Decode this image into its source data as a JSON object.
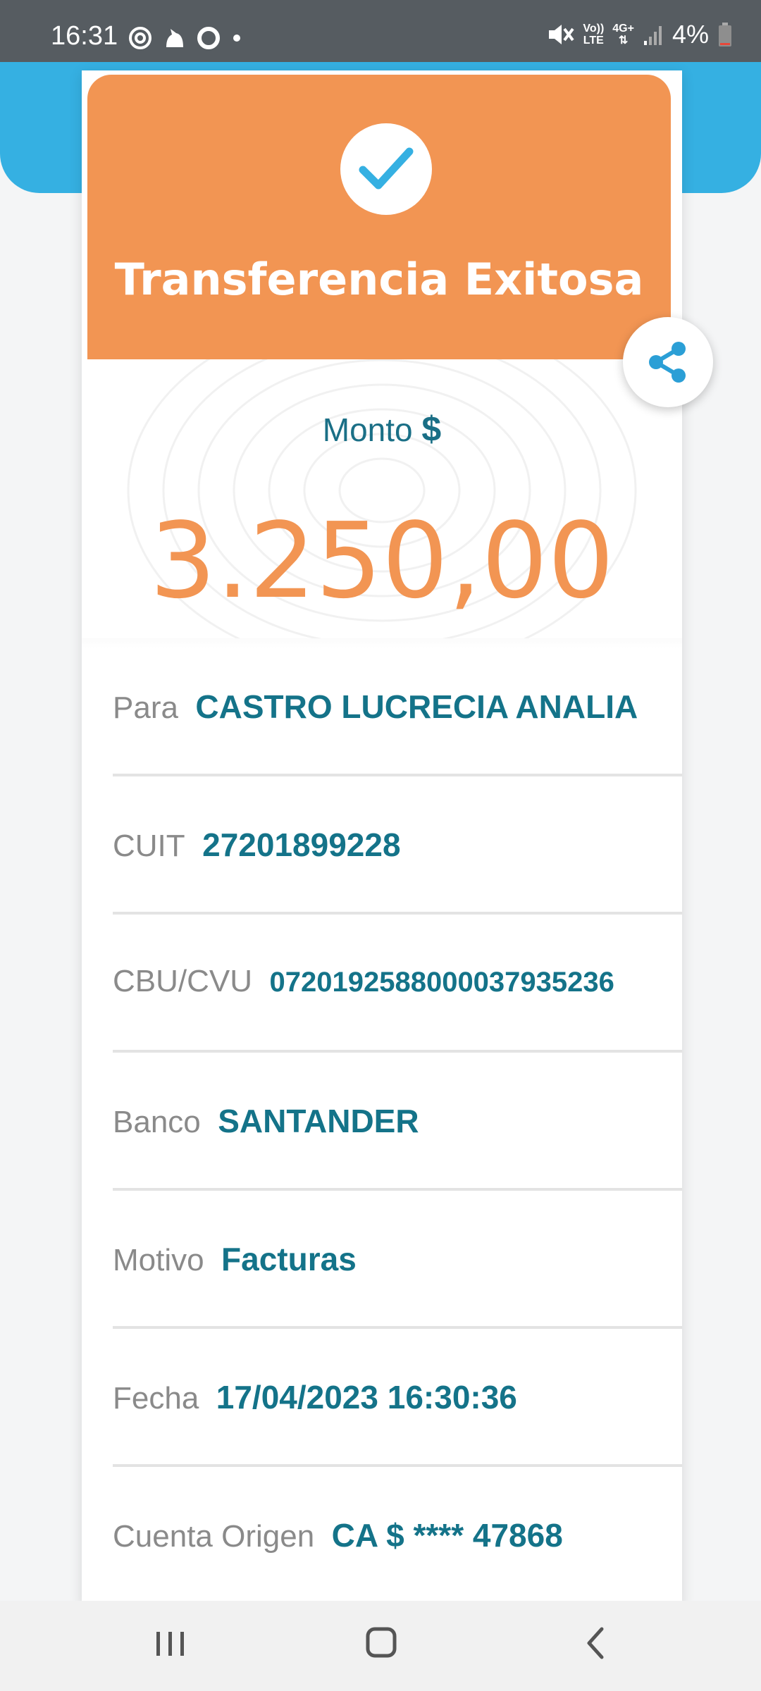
{
  "status_bar": {
    "time": "16:31",
    "network_top": "Vo))",
    "network_bottom": "LTE",
    "network_type": "4G+",
    "battery": "4%",
    "icons": [
      "at-sign-icon",
      "fox-icon",
      "ring-icon",
      "dot-icon",
      "mute-icon",
      "signal-icon",
      "battery-icon"
    ]
  },
  "receipt": {
    "title": "Transferencia Exitosa",
    "amount_label": "Monto",
    "currency_symbol": "$",
    "amount": "3.250,00",
    "rows": [
      {
        "label": "Para",
        "value": "CASTRO LUCRECIA ANALIA"
      },
      {
        "label": "CUIT",
        "value": "27201899228"
      },
      {
        "label": "CBU/CVU",
        "value": "0720192588000037935236"
      },
      {
        "label": "Banco",
        "value": "SANTANDER"
      },
      {
        "label": "Motivo",
        "value": "Facturas"
      },
      {
        "label": "Fecha",
        "value": "17/04/2023 16:30:36"
      },
      {
        "label": "Cuenta Origen",
        "value": "CA $ **** 47868"
      }
    ]
  },
  "colors": {
    "header_blue": "#35b0e2",
    "card_orange": "#f29553",
    "value_teal": "#147389",
    "label_gray": "#8a8a8a"
  },
  "navigation": {
    "icons": [
      "recent-apps-icon",
      "home-icon",
      "back-icon"
    ]
  }
}
